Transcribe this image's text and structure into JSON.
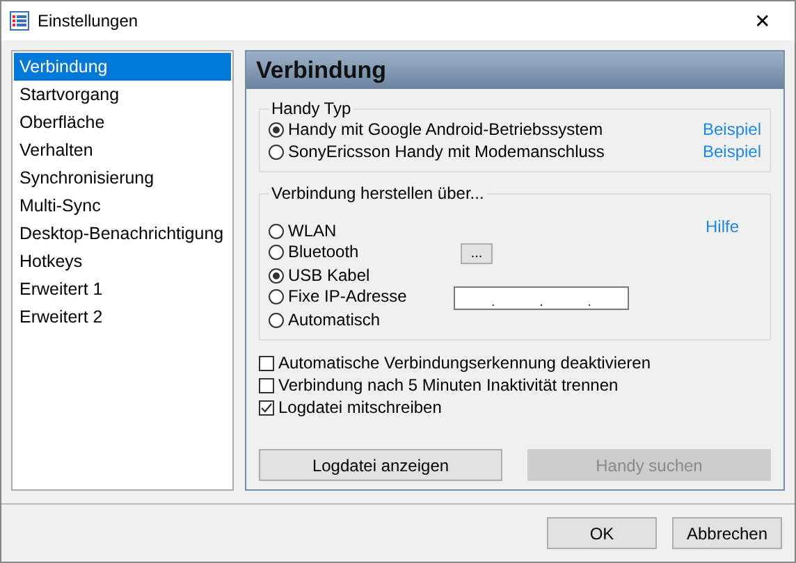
{
  "window": {
    "title": "Einstellungen",
    "close": "✕"
  },
  "sidebar": {
    "items": [
      {
        "label": "Verbindung",
        "selected": true
      },
      {
        "label": "Startvorgang",
        "selected": false
      },
      {
        "label": "Oberfläche",
        "selected": false
      },
      {
        "label": "Verhalten",
        "selected": false
      },
      {
        "label": "Synchronisierung",
        "selected": false
      },
      {
        "label": "Multi-Sync",
        "selected": false
      },
      {
        "label": "Desktop-Benachrichtigung",
        "selected": false
      },
      {
        "label": "Hotkeys",
        "selected": false
      },
      {
        "label": "Erweitert 1",
        "selected": false
      },
      {
        "label": "Erweitert 2",
        "selected": false
      }
    ]
  },
  "panel": {
    "title": "Verbindung",
    "phone_type": {
      "legend": "Handy Typ",
      "options": [
        {
          "label": "Handy mit Google Android-Betriebssystem",
          "selected": true,
          "link": "Beispiel"
        },
        {
          "label": "SonyEricsson Handy mit Modemanschluss",
          "selected": false,
          "link": "Beispiel"
        }
      ]
    },
    "connection": {
      "legend": "Verbindung herstellen über...",
      "help": "Hilfe",
      "options": [
        {
          "label": "WLAN",
          "selected": false,
          "kind": "plain"
        },
        {
          "label": "Bluetooth",
          "selected": false,
          "kind": "browse",
          "button": "..."
        },
        {
          "label": "USB Kabel",
          "selected": true,
          "kind": "plain"
        },
        {
          "label": "Fixe IP-Adresse",
          "selected": false,
          "kind": "ip",
          "separators": [
            ".",
            ".",
            "."
          ]
        },
        {
          "label": "Automatisch",
          "selected": false,
          "kind": "plain"
        }
      ]
    },
    "checkboxes": [
      {
        "label": "Automatische Verbindungserkennung deaktivieren",
        "checked": false
      },
      {
        "label": "Verbindung nach 5 Minuten Inaktivität trennen",
        "checked": false
      },
      {
        "label": "Logdatei mitschreiben",
        "checked": true
      }
    ],
    "buttons": [
      {
        "label": "Logdatei anzeigen",
        "disabled": false
      },
      {
        "label": "Handy suchen",
        "disabled": true
      }
    ]
  },
  "footer": {
    "buttons": [
      "OK",
      "Abbrechen"
    ]
  }
}
